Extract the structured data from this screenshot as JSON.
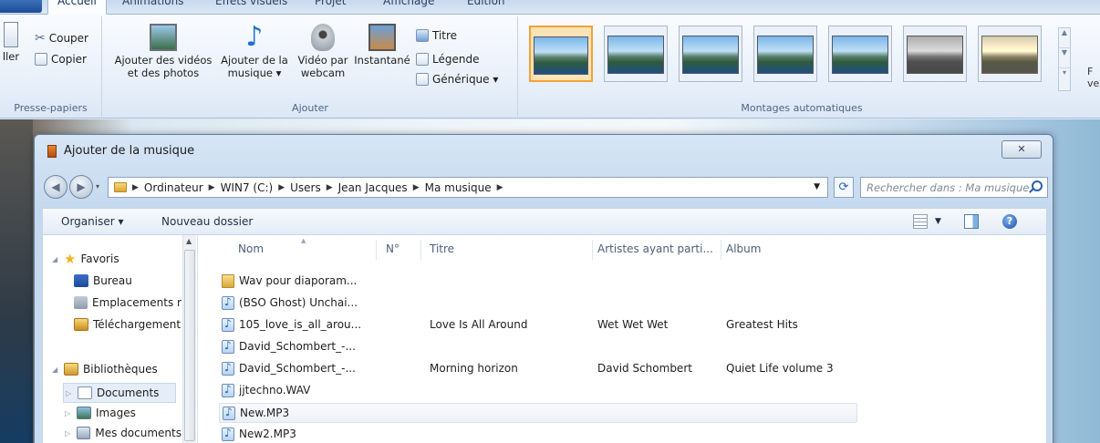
{
  "ribbon": {
    "tabs": [
      "Accueil",
      "Animations",
      "Effets visuels",
      "Projet",
      "Affichage",
      "Édition"
    ],
    "clipboard": {
      "paste_label": "ller",
      "cut_label": "Couper",
      "copy_label": "Copier",
      "group_label": "Presse-papiers"
    },
    "add": {
      "videos_photos": "Ajouter des vidéos\net des photos",
      "music": "Ajouter de la\nmusique ▾",
      "webcam": "Vidéo par\nwebcam",
      "snapshot": "Instantané",
      "title": "Titre",
      "caption": "Légende",
      "credits": "Générique ▾",
      "group_label": "Ajouter"
    },
    "themes_group_label": "Montages automatiques",
    "right_cut_label": "F\nve"
  },
  "dialog": {
    "title": "Ajouter de la musique",
    "close_glyph": "✕",
    "breadcrumb": [
      "Ordinateur",
      "WIN7 (C:)",
      "Users",
      "Jean Jacques",
      "Ma musique"
    ],
    "search_placeholder": "Rechercher dans : Ma musique",
    "toolbar": {
      "organize": "Organiser ▾",
      "new_folder": "Nouveau dossier"
    },
    "nav": [
      {
        "label": "Favoris",
        "icon": "star-icon"
      },
      {
        "label": "Bureau",
        "icon": "desktop-icon"
      },
      {
        "label": "Emplacements r",
        "icon": "recent-places-icon"
      },
      {
        "label": "Téléchargement",
        "icon": "downloads-icon"
      },
      {
        "label": "Bibliothèques",
        "icon": "libraries-icon"
      },
      {
        "label": "Documents",
        "icon": "documents-icon"
      },
      {
        "label": "Images",
        "icon": "pictures-icon"
      },
      {
        "label": "Mes documents",
        "icon": "my-documents-icon"
      }
    ],
    "columns": [
      "Nom",
      "N°",
      "Titre",
      "Artistes ayant parti...",
      "Album"
    ],
    "files": [
      {
        "name": "Wav pour diaporam...",
        "type": "folder",
        "title": "",
        "artist": "",
        "album": ""
      },
      {
        "name": "(BSO Ghost) Unchai...",
        "type": "music",
        "title": "",
        "artist": "",
        "album": ""
      },
      {
        "name": "105_love_is_all_arou...",
        "type": "music",
        "title": "Love Is All Around",
        "artist": "Wet Wet Wet",
        "album": "Greatest Hits"
      },
      {
        "name": "David_Schombert_-...",
        "type": "music",
        "title": "",
        "artist": "",
        "album": ""
      },
      {
        "name": "David_Schombert_-...",
        "type": "music",
        "title": "Morning horizon",
        "artist": "David Schombert",
        "album": "Quiet Life volume 3"
      },
      {
        "name": "jjtechno.WAV",
        "type": "music",
        "title": "",
        "artist": "",
        "album": ""
      },
      {
        "name": "New.MP3",
        "type": "music",
        "title": "",
        "artist": "",
        "album": ""
      },
      {
        "name": "New2.MP3",
        "type": "music",
        "title": "",
        "artist": "",
        "album": ""
      }
    ]
  }
}
